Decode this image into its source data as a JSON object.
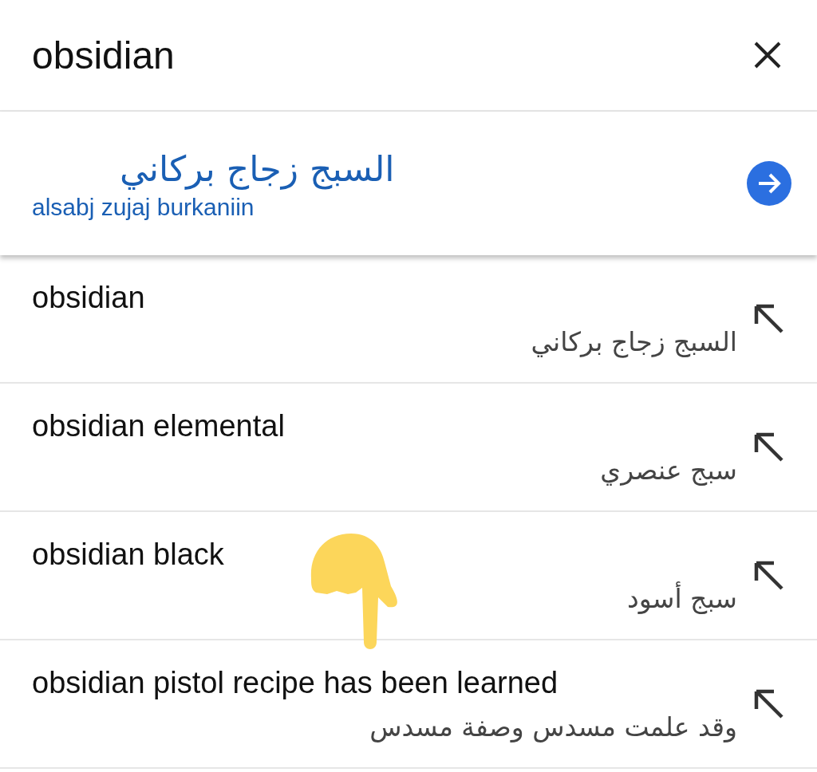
{
  "search": {
    "value": "obsidian"
  },
  "translation": {
    "text": "السبج زجاج بركاني",
    "romanization": "alsabj zujaj burkaniin"
  },
  "suggestions": [
    {
      "source": "obsidian",
      "target": "السبج زجاج بركاني"
    },
    {
      "source": "obsidian elemental",
      "target": "سبج عنصري"
    },
    {
      "source": "obsidian black",
      "target": "سبج أسود"
    },
    {
      "source": "obsidian pistol recipe has been learned",
      "target": "وقد علمت مسدس وصفة مسدس"
    }
  ]
}
